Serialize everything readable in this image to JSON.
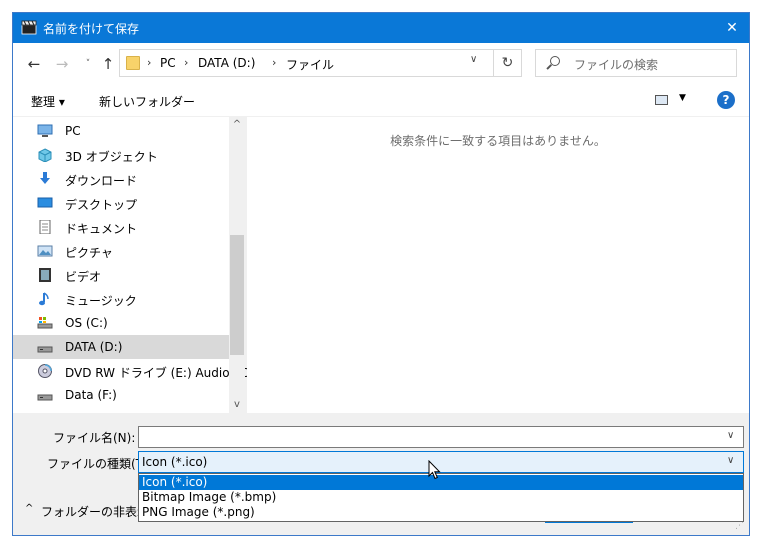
{
  "window": {
    "title": "名前を付けて保存",
    "close_glyph": "✕"
  },
  "nav": {
    "back_glyph": "←",
    "forward_glyph": "→",
    "recent_glyph": "˅",
    "up_glyph": "↑",
    "breadcrumbs": [
      "PC",
      "DATA (D:)",
      "ファイル"
    ],
    "crumb_separator": "›",
    "dropdown_glyph": "∨",
    "refresh_glyph": "↻",
    "search_placeholder": "ファイルの検索"
  },
  "toolbar": {
    "organize_label": "整理 ▾",
    "new_folder_label": "新しいフォルダー",
    "view_dropdown_glyph": "▼",
    "help_glyph": "?"
  },
  "sidebar": {
    "items": [
      {
        "label": "PC",
        "icon": "pc-icon"
      },
      {
        "label": "3D オブジェクト",
        "icon": "3d-objects-icon"
      },
      {
        "label": "ダウンロード",
        "icon": "download-icon"
      },
      {
        "label": "デスクトップ",
        "icon": "desktop-icon"
      },
      {
        "label": "ドキュメント",
        "icon": "documents-icon"
      },
      {
        "label": "ピクチャ",
        "icon": "pictures-icon"
      },
      {
        "label": "ビデオ",
        "icon": "video-icon"
      },
      {
        "label": "ミュージック",
        "icon": "music-icon"
      },
      {
        "label": "OS (C:)",
        "icon": "system-drive-icon"
      },
      {
        "label": "DATA (D:)",
        "icon": "drive-icon",
        "selected": true
      },
      {
        "label": "DVD RW ドライブ (E:) Audio CD",
        "icon": "dvd-drive-icon"
      },
      {
        "label": "Data (F:)",
        "icon": "drive-icon"
      }
    ],
    "scroll_up_glyph": "^",
    "scroll_down_glyph": "v"
  },
  "filepane": {
    "empty_message": "検索条件に一致する項目はありません。"
  },
  "bottom": {
    "filename_label": "ファイル名(N):",
    "filename_value": "",
    "filetype_label": "ファイルの種類(T):",
    "filetype_value": "Icon (*.ico)",
    "dropdown_glyph": "∨",
    "filetype_options": [
      "Icon (*.ico)",
      "Bitmap Image (*.bmp)",
      "PNG Image (*.png)"
    ],
    "hide_folders_label": "フォルダーの非表示",
    "hide_folders_glyph": "^",
    "grip_glyph": "⋰"
  },
  "colors": {
    "title_bar": "#0a78d7",
    "selection": "#0078d7",
    "selected_tree": "#d9d9d9"
  }
}
